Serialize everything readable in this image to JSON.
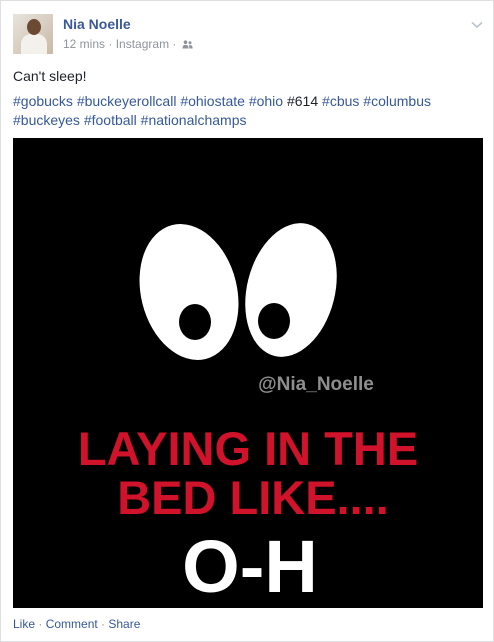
{
  "post": {
    "author": "Nia Noelle",
    "time": "12 mins",
    "source": "Instagram",
    "meta_sep": " · ",
    "text": "Can't sleep!",
    "hashtags_line1": [
      {
        "text": "#gobucks",
        "link": true
      },
      {
        "text": "#buckeyerollcall",
        "link": true
      },
      {
        "text": "#ohiostate",
        "link": true
      },
      {
        "text": "#ohio",
        "link": true
      },
      {
        "text": "#614",
        "link": false
      },
      {
        "text": "#cbus",
        "link": true
      },
      {
        "text": "#columbus",
        "link": true
      }
    ],
    "hashtags_line2": [
      {
        "text": "#buckeyes",
        "link": true
      },
      {
        "text": "#football",
        "link": true
      },
      {
        "text": "#nationalchamps",
        "link": true
      }
    ]
  },
  "image": {
    "watermark": "@Nia_Noelle",
    "line1": "LAYING IN THE",
    "line2": "BED LIKE....",
    "line3": "O-H",
    "red": "#d0122b",
    "eye_white": "#ffffff",
    "pupil": "#000000"
  },
  "actions": {
    "like": "Like",
    "comment": "Comment",
    "share": "Share",
    "sep": " · "
  },
  "icons": [
    "friends-icon",
    "chevron-down-icon"
  ],
  "colors": {
    "link": "#365899",
    "name": "#3b5998",
    "meta": "#90949c",
    "text": "#1d2129"
  }
}
